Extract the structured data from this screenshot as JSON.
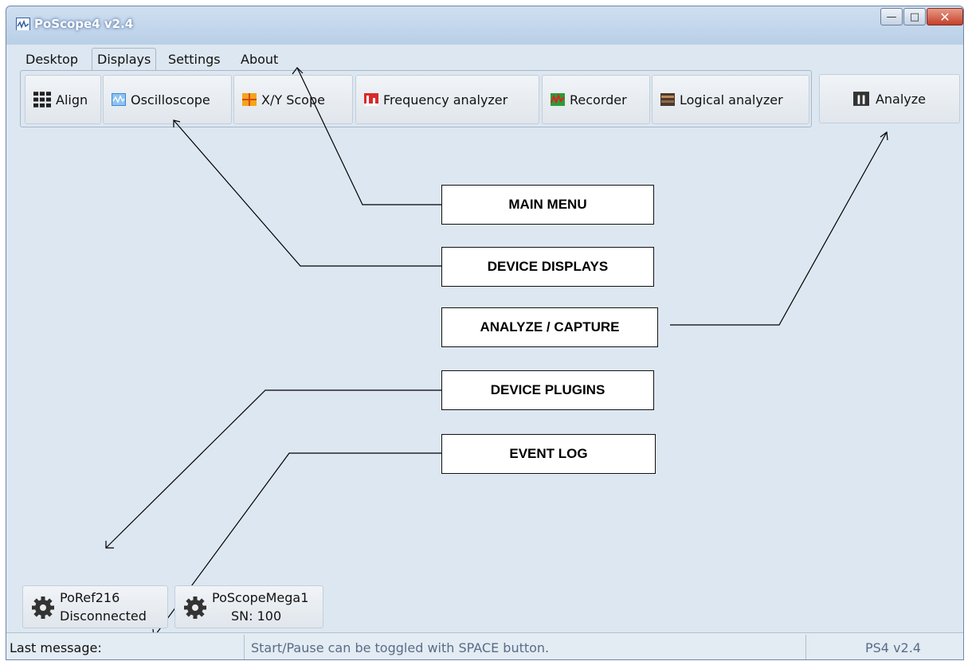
{
  "window": {
    "title": "PoScope4 v2.4"
  },
  "titlebar_buttons": {
    "minimize": "—",
    "maximize": "□",
    "close": "✕"
  },
  "menu": {
    "items": [
      "Desktop",
      "Displays",
      "Settings",
      "About"
    ],
    "active": "Displays"
  },
  "toolbar": {
    "buttons": [
      {
        "label": "Align",
        "icon": "grid-icon"
      },
      {
        "label": "Oscilloscope",
        "icon": "oscilloscope-icon"
      },
      {
        "label": "X/Y Scope",
        "icon": "xy-scope-icon"
      },
      {
        "label": "Frequency analyzer",
        "icon": "frequency-analyzer-icon"
      },
      {
        "label": "Recorder",
        "icon": "recorder-icon"
      },
      {
        "label": "Logical analyzer",
        "icon": "logic-analyzer-icon"
      }
    ],
    "analyze": {
      "label": "Analyze",
      "icon": "pause-icon"
    }
  },
  "callouts": {
    "main_menu": "MAIN MENU",
    "device_displays": "DEVICE DISPLAYS",
    "analyze_capture": "ANALYZE / CAPTURE",
    "device_plugins": "DEVICE PLUGINS",
    "event_log": "EVENT LOG"
  },
  "plugins": [
    {
      "name": "PoRef216",
      "status": "Disconnected",
      "icon": "gear-icon"
    },
    {
      "name": "PoScopeMega1",
      "status": "SN: 100",
      "icon": "gear-icon"
    }
  ],
  "statusbar": {
    "label": "Last message:",
    "message": "Start/Pause can be toggled with SPACE button.",
    "version": "PS4 v2.4"
  },
  "colors": {
    "window_bg": "#dde7f1",
    "accent_title": "#2d5fa8",
    "close_red": "#c5402a"
  }
}
